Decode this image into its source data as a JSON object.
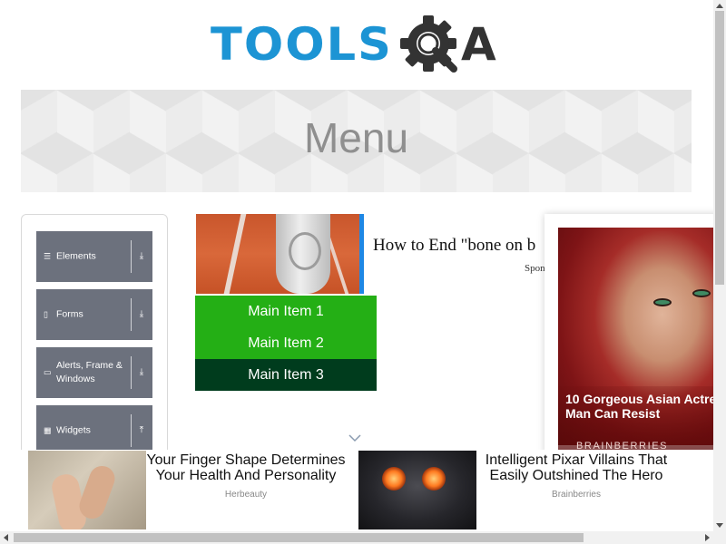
{
  "header": {
    "logo_text_tools": "TOOLS",
    "logo_text_a": "A"
  },
  "banner": {
    "title": "Menu"
  },
  "sidebar": {
    "items": [
      {
        "label": "Elements",
        "icon": "list-icon",
        "arrow": "⤓"
      },
      {
        "label": "Forms",
        "icon": "form-icon",
        "arrow": "⤓"
      },
      {
        "label": "Alerts, Frame & Windows",
        "icon": "window-icon",
        "arrow": "⤓"
      },
      {
        "label": "Widgets",
        "icon": "grid-icon",
        "arrow": "⤒"
      }
    ]
  },
  "main": {
    "menu_items": [
      {
        "label": "Main Item 1"
      },
      {
        "label": "Main Item 2"
      },
      {
        "label": "Main Item 3"
      }
    ]
  },
  "ads": {
    "top": {
      "title": "How to End \"bone on b",
      "sponsor": "Spon"
    },
    "right": {
      "title": "10 Gorgeous Asian Actre Man Can Resist",
      "title_line1": "10 Gorgeous Asian Actre",
      "title_line2": "Man Can Resist",
      "source": "BRAINBERRIES"
    },
    "bottom": [
      {
        "title": "Your Finger Shape Determines Your Health And Personality",
        "source": "Herbeauty"
      },
      {
        "title": "Intelligent Pixar Villains That Easily Outshined The Hero",
        "source": "Brainberries"
      }
    ]
  },
  "colors": {
    "logo_blue": "#1c94d4",
    "menu_green": "#24af15",
    "menu_active": "#003c1d",
    "sidebar_item": "#6c717d"
  }
}
